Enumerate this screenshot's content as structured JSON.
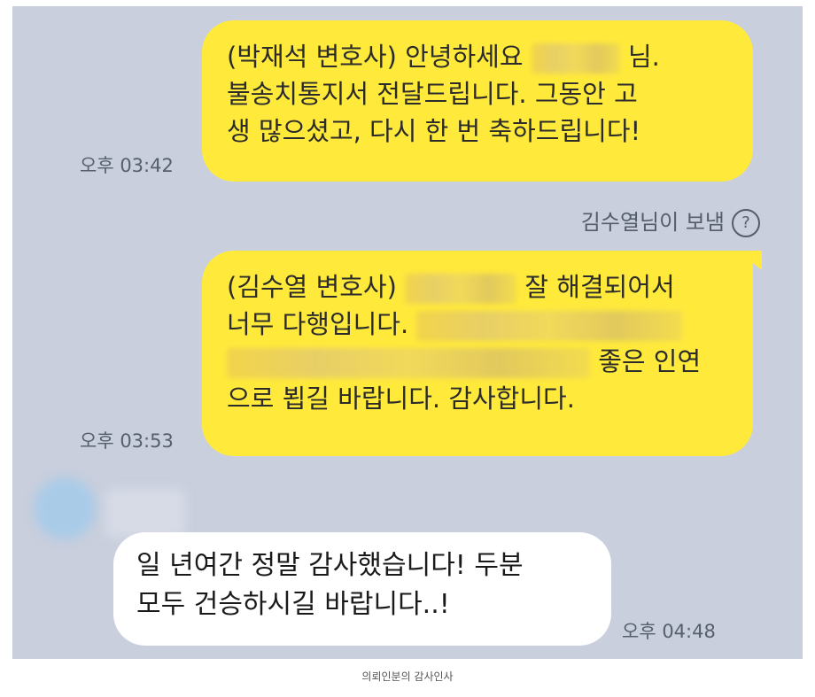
{
  "messages": [
    {
      "time": "오후 03:42",
      "lines": {
        "l1_prefix": "(박재석 변호사) 안녕하세요",
        "l1_suffix": "님.",
        "l2": "불송치통지서 전달드립니다. 그동안 고",
        "l3": "생 많으셨고, 다시 한 번 축하드립니다!"
      }
    },
    {
      "sender_note": "김수열님이 보냄",
      "help_glyph": "?",
      "time": "오후 03:53",
      "lines": {
        "l1_prefix": "(김수열 변호사)",
        "l1_suffix": "잘 해결되어서",
        "l2": "너무 다행입니다.",
        "l3_suffix": "좋은 인연",
        "l4": "으로 뵙길 바랍니다. 감사합니다."
      }
    },
    {
      "time": "오후 04:48",
      "lines": {
        "l1": "일 년여간 정말 감사했습니다! 두분",
        "l2": "모두 건승하시길 바랍니다..!"
      }
    }
  ],
  "caption": "의뢰인분의 감사인사",
  "colors": {
    "background": "#c9cfdd",
    "my_bubble": "#ffea3c",
    "their_bubble": "#ffffff"
  }
}
